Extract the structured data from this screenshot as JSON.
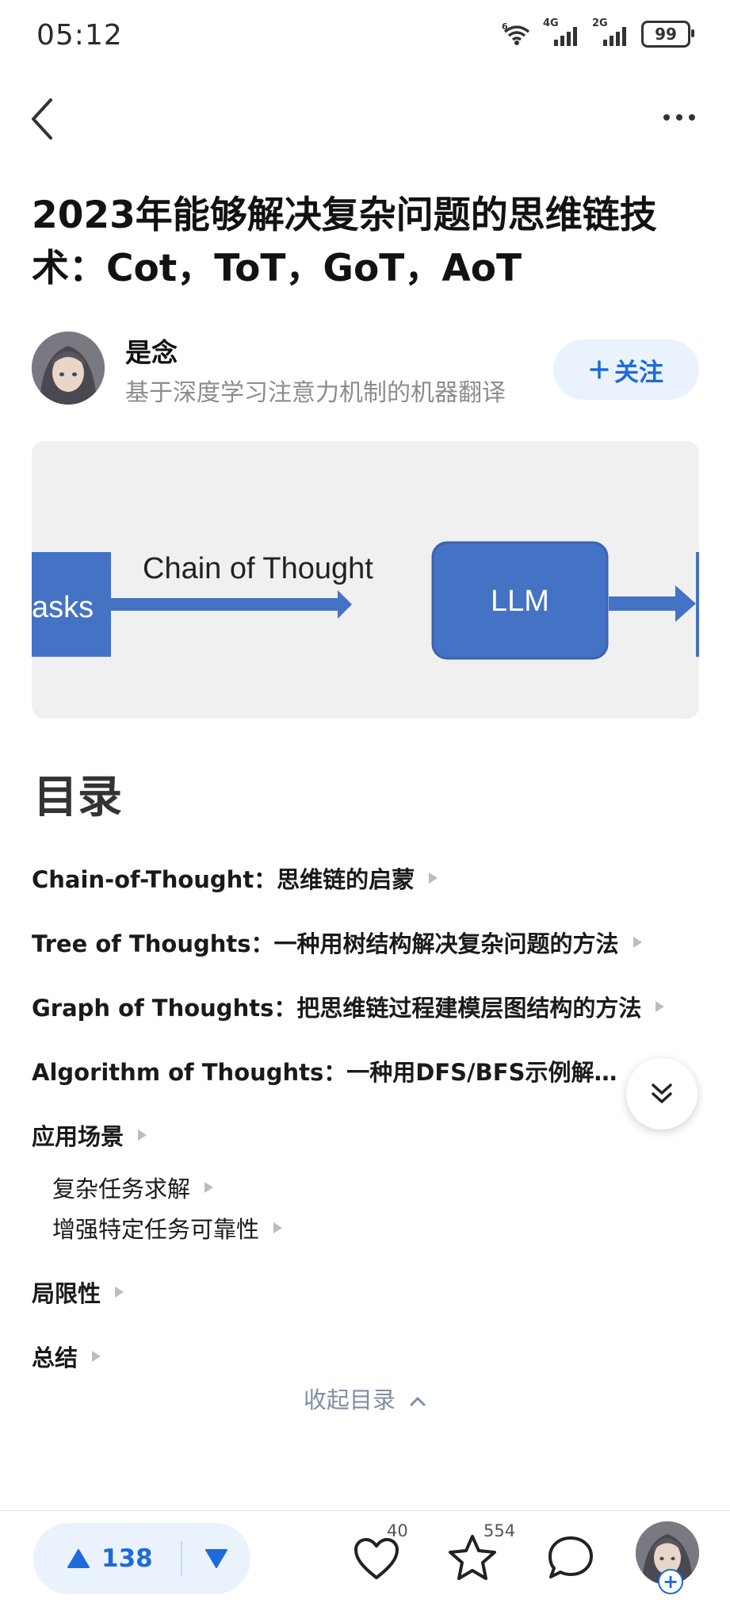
{
  "status_bar": {
    "time": "05:12",
    "battery": "99",
    "signal_1": "4G",
    "signal_2": "2G",
    "wifi_badge": "6"
  },
  "header": {
    "back_icon": "chevron-left-icon",
    "more_icon": "more-horizontal-icon"
  },
  "article": {
    "title": "2023年能够解决复杂问题的思维链技术：Cot，ToT，GoT，AoT",
    "author": {
      "name": "是念",
      "bio": "基于深度学习注意力机制的机器翻译"
    },
    "follow_label": "关注",
    "hero": {
      "left_label": "asks",
      "arrow_label": "Chain of Thought",
      "box_label": "LLM"
    }
  },
  "toc": {
    "heading": "目录",
    "items": [
      {
        "label": "Chain-of-Thought：思维链的启蒙"
      },
      {
        "label": "Tree of Thoughts：一种用树结构解决复杂问题的方法"
      },
      {
        "label": "Graph of Thoughts：把思维链过程建模层图结构的方法"
      },
      {
        "label": "Algorithm of Thoughts：一种用DFS/BFS示例解决问题的方法"
      },
      {
        "label": "应用场景"
      }
    ],
    "sub_items": [
      {
        "label": "复杂任务求解"
      },
      {
        "label": "增强特定任务可靠性"
      }
    ],
    "tail_items": [
      {
        "label": "局限性"
      },
      {
        "label": "总结"
      }
    ],
    "collapse_label": "收起目录"
  },
  "bottom_bar": {
    "upvote_count": "138",
    "like_count": "40",
    "favorite_count": "554"
  },
  "colors": {
    "accent": "#1e6ad8",
    "hero_blue": "#4472c4",
    "muted": "#8c8c8c"
  }
}
